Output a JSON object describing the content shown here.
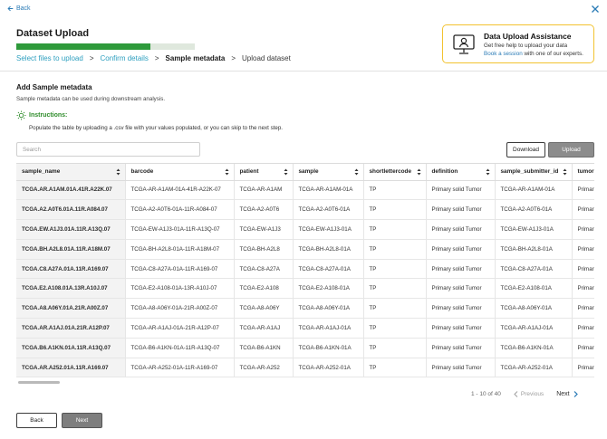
{
  "nav": {
    "back_label": "Back"
  },
  "page": {
    "title": "Dataset Upload",
    "progress": 0.75
  },
  "steps": [
    {
      "label": "Select files to upload",
      "state": "done"
    },
    {
      "label": "Confirm details",
      "state": "done"
    },
    {
      "label": "Sample metadata",
      "state": "active"
    },
    {
      "label": "Upload dataset",
      "state": "todo"
    }
  ],
  "assistance": {
    "title": "Data Upload Assistance",
    "line1": "Get free help to upload your data",
    "link": "Book a session",
    "line2_rest": " with one of our experts."
  },
  "section": {
    "title": "Add Sample metadata",
    "subtitle": "Sample metadata can be used during downstream analysis.",
    "instructions_label": "Instructions:",
    "instructions_text": "Populate the table by uploading a .csv file with your values populated, or you can skip to the next step."
  },
  "search": {
    "placeholder": "Search"
  },
  "toolbar": {
    "download_label": "Download",
    "upload_label": "Upload"
  },
  "table": {
    "columns": [
      "sample_name",
      "barcode",
      "patient",
      "sample",
      "shortlettercode",
      "definition",
      "sample_submitter_id",
      "tumor"
    ],
    "rows": [
      [
        "TCGA.AR.A1AM.01A.41R.A22K.07",
        "TCGA-AR-A1AM-01A-41R-A22K-07",
        "TCGA-AR-A1AM",
        "TCGA-AR-A1AM-01A",
        "TP",
        "Primary solid Tumor",
        "TCGA-AR-A1AM-01A",
        "Primar"
      ],
      [
        "TCGA.A2.A0T6.01A.11R.A084.07",
        "TCGA-A2-A0T6-01A-11R-A084-07",
        "TCGA-A2-A0T6",
        "TCGA-A2-A0T6-01A",
        "TP",
        "Primary solid Tumor",
        "TCGA-A2-A0T6-01A",
        "Primar"
      ],
      [
        "TCGA.EW.A1J3.01A.11R.A13Q.07",
        "TCGA-EW-A1J3-01A-11R-A13Q-07",
        "TCGA-EW-A1J3",
        "TCGA-EW-A1J3-01A",
        "TP",
        "Primary solid Tumor",
        "TCGA-EW-A1J3-01A",
        "Primar"
      ],
      [
        "TCGA.BH.A2L8.01A.11R.A18M.07",
        "TCGA-BH-A2L8-01A-11R-A18M-07",
        "TCGA-BH-A2L8",
        "TCGA-BH-A2L8-01A",
        "TP",
        "Primary solid Tumor",
        "TCGA-BH-A2L8-01A",
        "Primar"
      ],
      [
        "TCGA.C8.A27A.01A.11R.A169.07",
        "TCGA-C8-A27A-01A-11R-A169-07",
        "TCGA-C8-A27A",
        "TCGA-C8-A27A-01A",
        "TP",
        "Primary solid Tumor",
        "TCGA-C8-A27A-01A",
        "Primar"
      ],
      [
        "TCGA.E2.A108.01A.13R.A10J.07",
        "TCGA-E2-A108-01A-13R-A10J-07",
        "TCGA-E2-A108",
        "TCGA-E2-A108-01A",
        "TP",
        "Primary solid Tumor",
        "TCGA-E2-A108-01A",
        "Primar"
      ],
      [
        "TCGA.A8.A06Y.01A.21R.A00Z.07",
        "TCGA-A8-A06Y-01A-21R-A00Z-07",
        "TCGA-A8-A06Y",
        "TCGA-A8-A06Y-01A",
        "TP",
        "Primary solid Tumor",
        "TCGA-A8-A06Y-01A",
        "Primar"
      ],
      [
        "TCGA.AR.A1AJ.01A.21R.A12P.07",
        "TCGA-AR-A1AJ-01A-21R-A12P-07",
        "TCGA-AR-A1AJ",
        "TCGA-AR-A1AJ-01A",
        "TP",
        "Primary solid Tumor",
        "TCGA-AR-A1AJ-01A",
        "Primar"
      ],
      [
        "TCGA.B6.A1KN.01A.11R.A13Q.07",
        "TCGA-B6-A1KN-01A-11R-A13Q-07",
        "TCGA-B6-A1KN",
        "TCGA-B6-A1KN-01A",
        "TP",
        "Primary solid Tumor",
        "TCGA-B6-A1KN-01A",
        "Primar"
      ],
      [
        "TCGA.AR.A252.01A.11R.A169.07",
        "TCGA-AR-A252-01A-11R-A169-07",
        "TCGA-AR-A252",
        "TCGA-AR-A252-01A",
        "TP",
        "Primary solid Tumor",
        "TCGA-AR-A252-01A",
        "Primar"
      ]
    ]
  },
  "pagination": {
    "range": "1 - 10 of 40",
    "prev_label": "Previous",
    "next_label": "Next"
  },
  "footer": {
    "back_label": "Back",
    "next_label": "Next"
  },
  "colors": {
    "accent": "#2e9a3b",
    "link": "#2a7bb6",
    "step_done": "#2d9fbf",
    "assist_border": "#f2c230"
  }
}
